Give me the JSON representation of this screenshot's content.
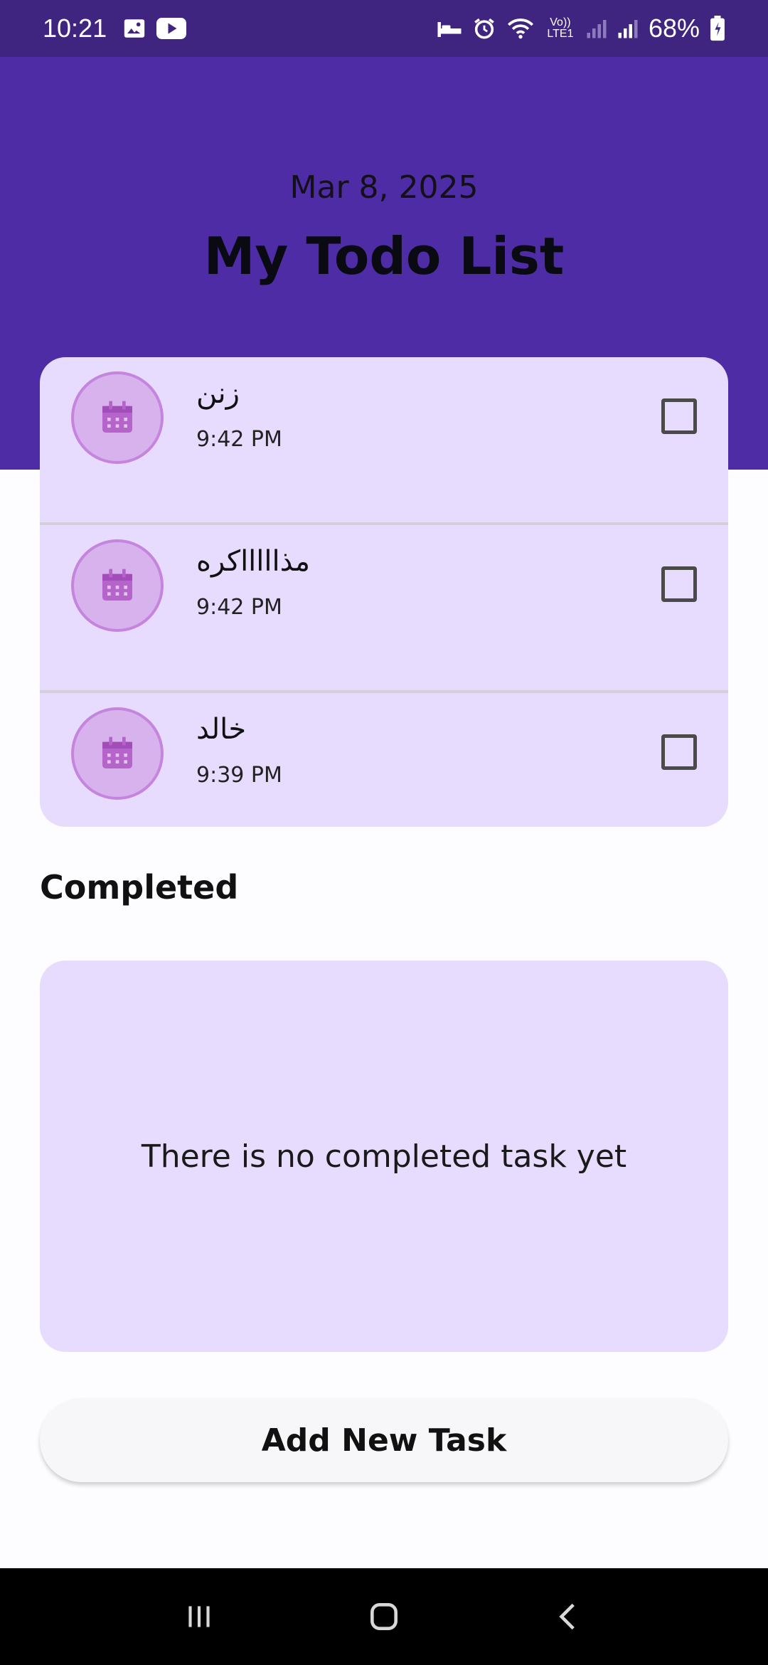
{
  "status_bar": {
    "time": "10:21",
    "battery": "68%",
    "network": "Vo)) LTE1",
    "icons": [
      "image-icon",
      "youtube-icon",
      "sleep-icon",
      "alarm-icon",
      "wifi-icon",
      "signal-icon",
      "signal-icon",
      "battery-icon"
    ]
  },
  "header": {
    "date": "Mar 8, 2025",
    "title": "My Todo List",
    "color": "#4e2ca5"
  },
  "todos": [
    {
      "name": "زنن",
      "time": "9:42 PM",
      "checked": false,
      "icon": "calendar-icon"
    },
    {
      "name": "مذاااااكره",
      "time": "9:42 PM",
      "checked": false,
      "icon": "calendar-icon"
    },
    {
      "name": "خالد",
      "time": "9:39 PM",
      "checked": false,
      "icon": "calendar-icon"
    }
  ],
  "completed": {
    "heading": "Completed",
    "empty_text": "There is no completed task yet"
  },
  "actions": {
    "add_label": "Add New Task"
  },
  "nav": {
    "icons": [
      "recents-icon",
      "home-icon",
      "back-icon"
    ]
  }
}
